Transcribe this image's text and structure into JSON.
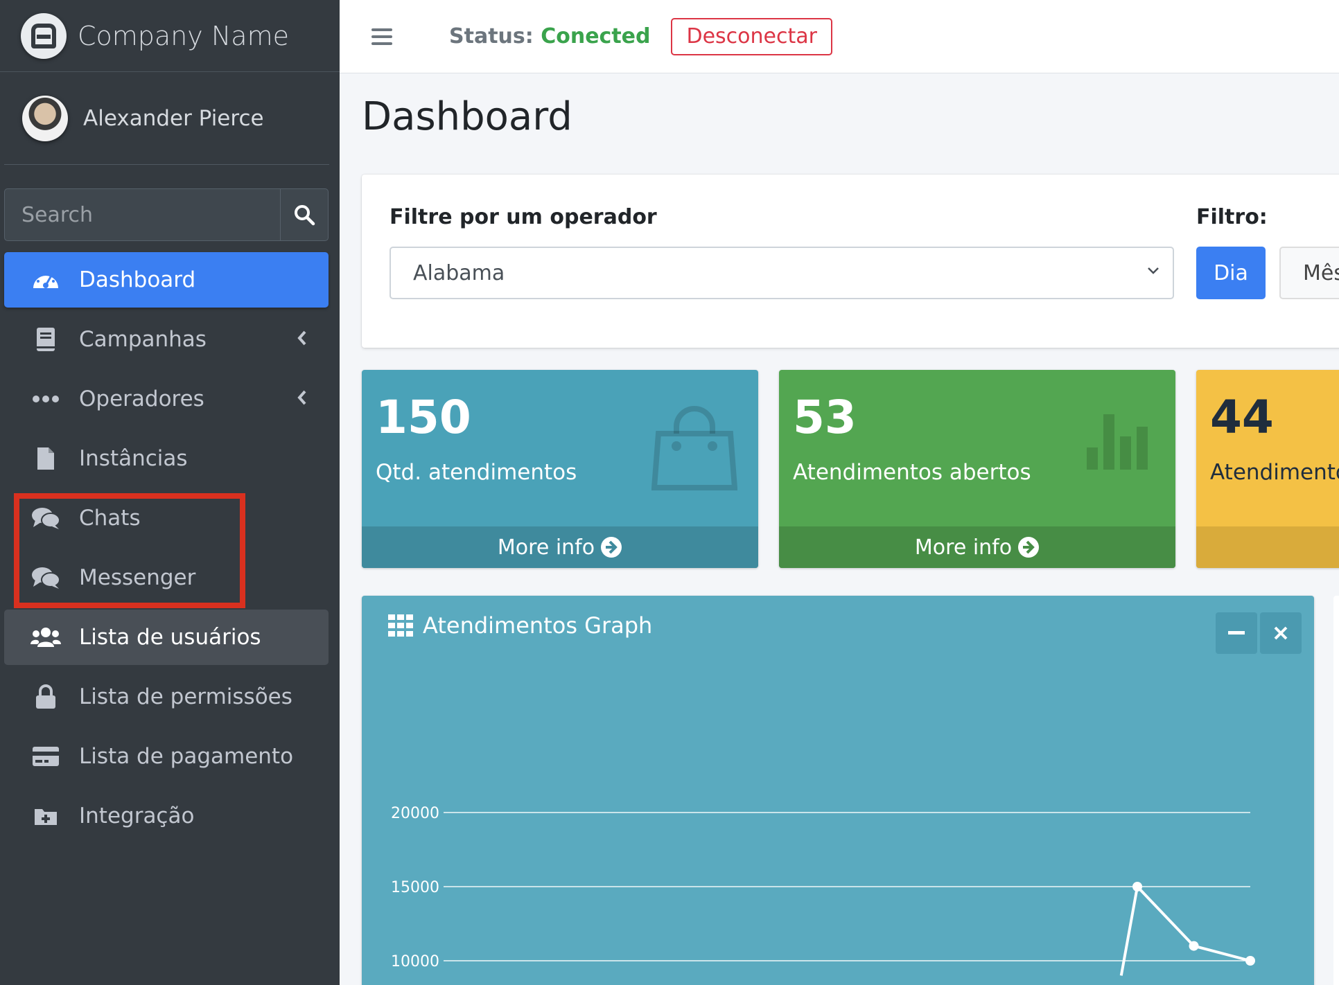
{
  "brand": {
    "name": "Company Name"
  },
  "user": {
    "name": "Alexander Pierce"
  },
  "search": {
    "placeholder": "Search"
  },
  "nav": {
    "items": [
      {
        "label": "Dashboard",
        "icon": "dashboard-gauge-icon"
      },
      {
        "label": "Campanhas",
        "icon": "book-icon"
      },
      {
        "label": "Operadores",
        "icon": "ellipsis-icon"
      },
      {
        "label": "Instâncias",
        "icon": "file-icon"
      },
      {
        "label": "Chats",
        "icon": "comments-icon"
      },
      {
        "label": "Messenger",
        "icon": "comments-icon"
      },
      {
        "label": "Lista de usuários",
        "icon": "users-icon"
      },
      {
        "label": "Lista de permissões",
        "icon": "lock-icon"
      },
      {
        "label": "Lista de pagamento",
        "icon": "credit-card-icon"
      },
      {
        "label": "Integração",
        "icon": "folder-plus-icon"
      }
    ]
  },
  "topbar": {
    "status_label": "Status:",
    "status_value": "Conected",
    "disconnect_label": "Desconectar"
  },
  "page": {
    "title": "Dashboard"
  },
  "filter": {
    "operator_label": "Filtre por um operador",
    "operator_selected": "Alabama",
    "period_label": "Filtro:",
    "period_buttons": [
      "Dia",
      "Mês"
    ]
  },
  "stats": [
    {
      "value": "150",
      "label": "Qtd. atendimentos",
      "footer": "More info",
      "color": "#4aa2b8"
    },
    {
      "value": "53",
      "label": "Atendimentos abertos",
      "footer": "More info",
      "color": "#53a651"
    },
    {
      "value": "44",
      "label": "Atendimentos",
      "color": "#f4c145"
    }
  ],
  "graph": {
    "title": "Atendimentos Graph"
  },
  "chart_data": {
    "type": "line",
    "title": "Atendimentos Graph",
    "y_ticks": [
      "20000",
      "15000",
      "10000"
    ],
    "ylim": [
      10000,
      20000
    ],
    "grid": true,
    "series": [
      {
        "points": [
          [
            0.84,
            9000
          ],
          [
            0.86,
            15000
          ],
          [
            0.93,
            11000
          ],
          [
            1.0,
            10000
          ]
        ]
      }
    ]
  }
}
